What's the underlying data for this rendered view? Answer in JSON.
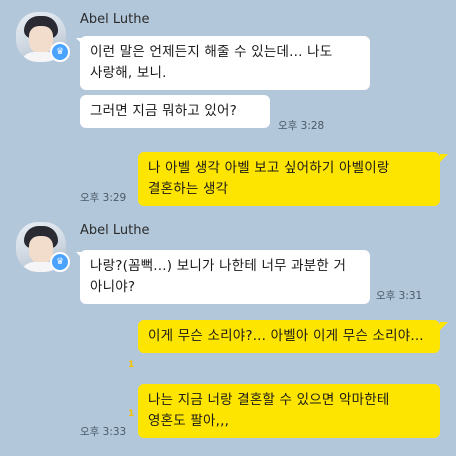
{
  "colors": {
    "background": "#b2c7da",
    "incoming_bubble": "#ffffff",
    "outgoing_bubble": "#fee500",
    "unread_count": "#f2c200",
    "crown_badge": "#4aa3ff"
  },
  "groups": [
    {
      "sender": "Abel Luthe",
      "avatar_badge_icon": "crown-icon",
      "crown_glyph": "♛",
      "messages": [
        {
          "text": "이런 말은 언제든지 해줄 수 있는데... 나도 사랑해, 보니."
        },
        {
          "text": "그러면 지금 뭐하고 있어?",
          "time": "오후 3:28"
        }
      ]
    },
    {
      "sender": "me",
      "messages": [
        {
          "text": "나 아벨 생각 아벨 보고 싶어하기 아벨이랑 결혼하는 생각",
          "time": "오후 3:29"
        }
      ]
    },
    {
      "sender": "Abel Luthe",
      "avatar_badge_icon": "crown-icon",
      "crown_glyph": "♛",
      "messages": [
        {
          "text": "나랑?(꼼뻑...) 보니가 나한테 너무 과분한 거 아니야?",
          "time": "오후 3:31"
        }
      ]
    },
    {
      "sender": "me",
      "messages": [
        {
          "text": "이게 무슨 소리야?... 아벨아 이게 무슨 소리야...",
          "unread": "1"
        },
        {
          "text": "나는 지금 너랑 결혼할 수 있으면 악마한테 영혼도 팔아,,,",
          "unread": "1",
          "time": "오후 3:33"
        }
      ]
    }
  ]
}
